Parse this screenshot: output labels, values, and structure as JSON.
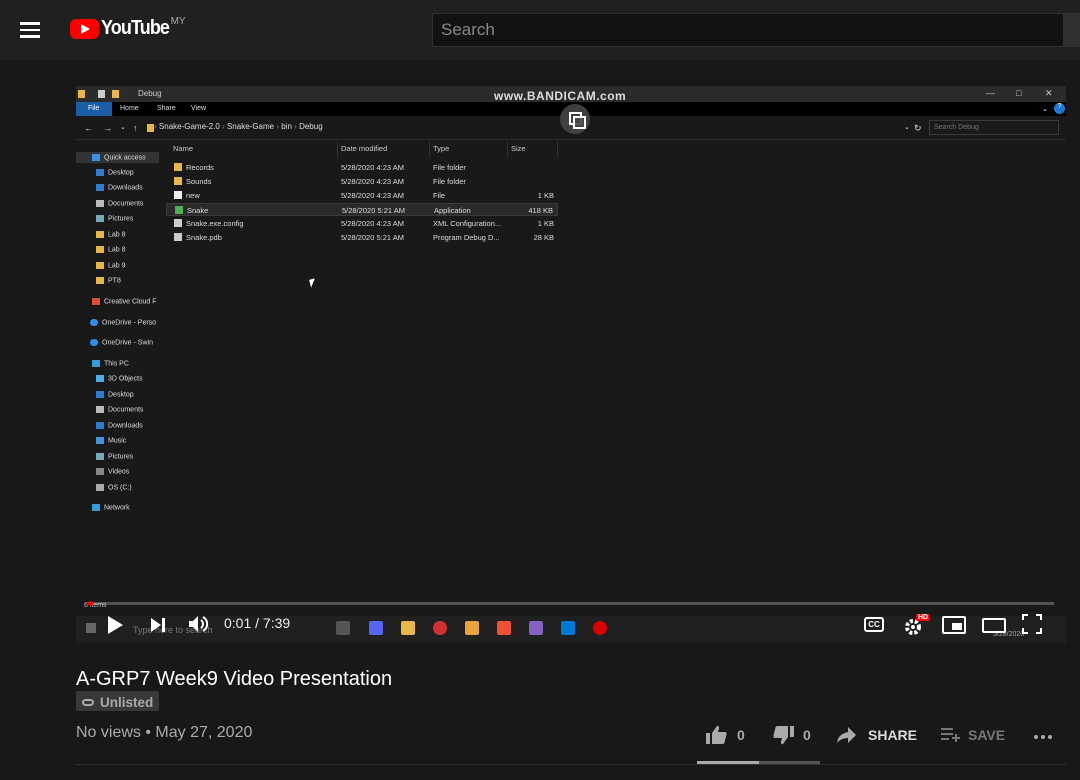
{
  "masthead": {
    "logo_text": "YouTube",
    "country_code": "MY",
    "search_placeholder": "Search"
  },
  "video_frame": {
    "watermark": "www.BANDICAM.com",
    "explorer_title": "Debug",
    "ribbon_tabs": [
      "File",
      "Home",
      "Share",
      "View"
    ],
    "breadcrumb": [
      "Snake-Game-2.0",
      "Snake-Game",
      "bin",
      "Debug"
    ],
    "search_placeholder": "Search Debug",
    "nav_items": [
      "Quick access",
      "Desktop",
      "Downloads",
      "Documents",
      "Pictures",
      "Lab 8",
      "Lab 8",
      "Lab 9",
      "PT8",
      "Creative Cloud F",
      "OneDrive - Perso",
      "OneDrive - Swin",
      "This PC",
      "3D Objects",
      "Desktop",
      "Documents",
      "Downloads",
      "Music",
      "Pictures",
      "Videos",
      "OS (C:)",
      "Network"
    ],
    "columns": [
      "Name",
      "Date modified",
      "Type",
      "Size"
    ],
    "files": [
      {
        "name": "Records",
        "date": "5/28/2020 4:23 AM",
        "type": "File folder",
        "size": ""
      },
      {
        "name": "Sounds",
        "date": "5/28/2020 4:23 AM",
        "type": "File folder",
        "size": ""
      },
      {
        "name": "new",
        "date": "5/28/2020 4:23 AM",
        "type": "File",
        "size": "1 KB"
      },
      {
        "name": "Snake",
        "date": "5/28/2020 5:21 AM",
        "type": "Application",
        "size": "418 KB"
      },
      {
        "name": "Snake.exe.config",
        "date": "5/28/2020 4:23 AM",
        "type": "XML Configuration...",
        "size": "1 KB"
      },
      {
        "name": "Snake.pdb",
        "date": "5/28/2020 5:21 AM",
        "type": "Program Debug D...",
        "size": "28 KB"
      }
    ],
    "status_text": "6 items",
    "taskbar_search": "Type here to search",
    "taskbar_clock": "5/28/2020"
  },
  "player": {
    "time_display": "0:01 / 7:39",
    "progress": 0.002,
    "hd_badge": "HD",
    "cc_label": "CC"
  },
  "video": {
    "title": "A-GRP7 Week9 Video Presentation",
    "privacy_badge": "Unlisted",
    "views": "No views",
    "separator": "•",
    "date": "May 27, 2020",
    "likes": "0",
    "dislikes": "0",
    "share_label": "SHARE",
    "save_label": "SAVE"
  },
  "colors": {
    "background": "#181818",
    "masthead": "#202020",
    "accent": "#ff0000"
  }
}
